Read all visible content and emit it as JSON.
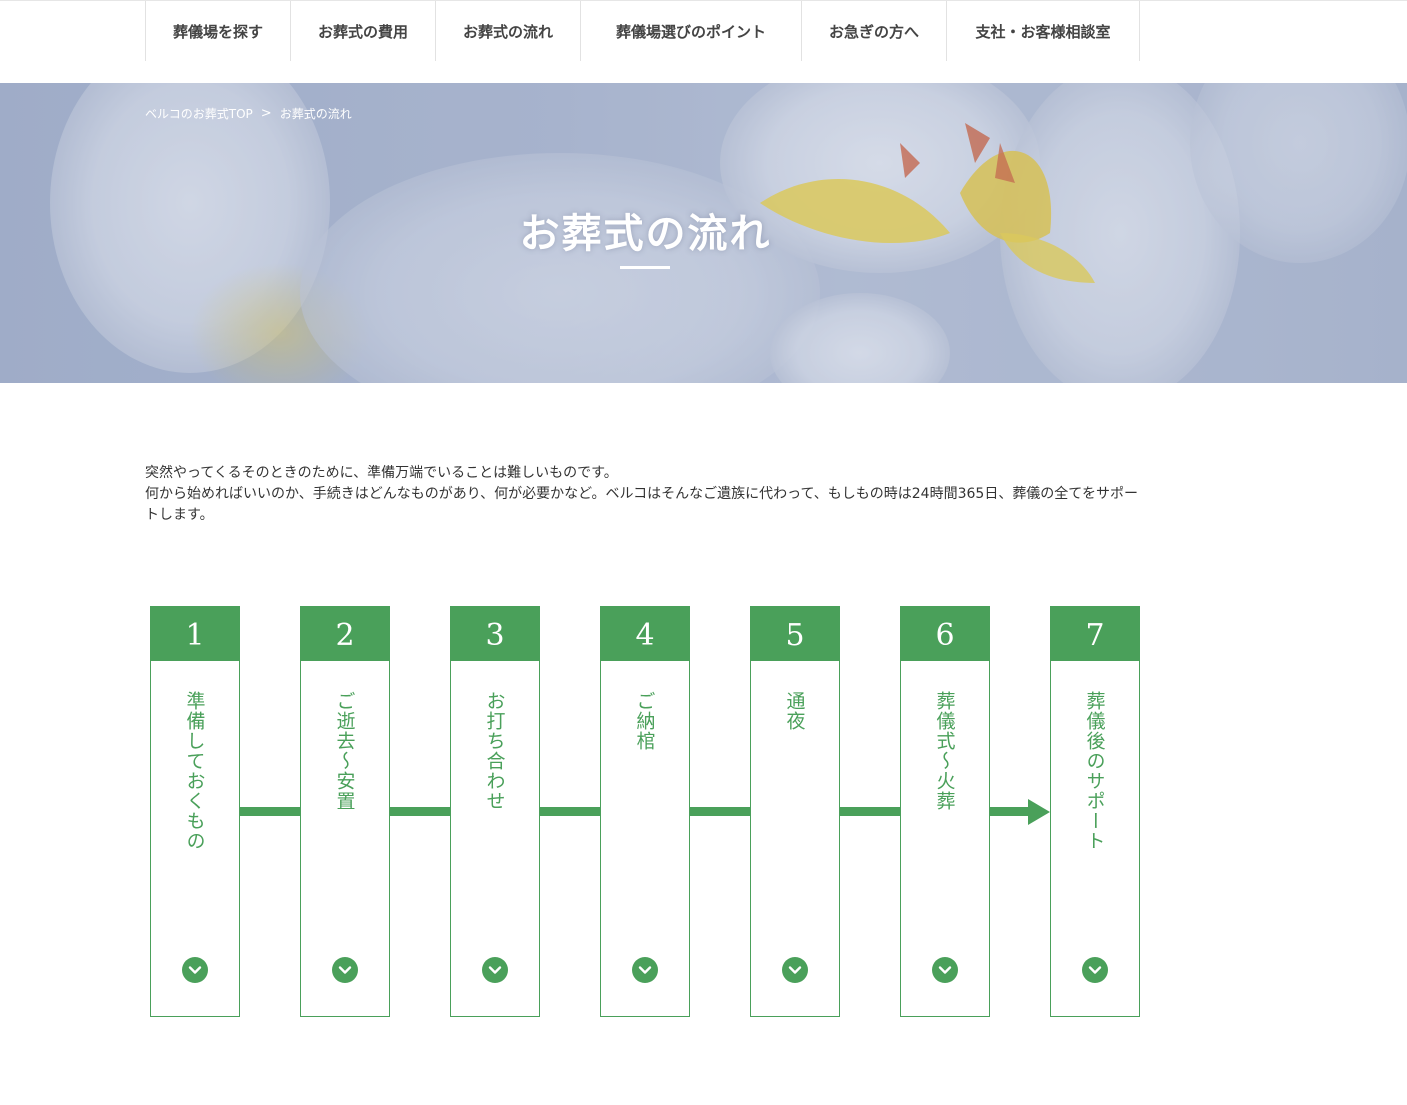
{
  "nav": {
    "items": [
      "葬儀場を探す",
      "お葬式の費用",
      "お葬式の流れ",
      "葬儀場選びのポイント",
      "お急ぎの方へ",
      "支社・お客様相談室"
    ]
  },
  "breadcrumb": {
    "home": "ベルコのお葬式TOP",
    "separator": ">",
    "current": "お葬式の流れ"
  },
  "hero": {
    "title": "お葬式の流れ"
  },
  "intro": {
    "line1": "突然やってくるそのときのために、準備万端でいることは難しいものです。",
    "line2": "何から始めればいいのか、手続きはどんなものがあり、何が必要かなど。ベルコはそんなご遺族に代わって、もしもの時は24時間365日、葬儀の全てをサポートします。"
  },
  "steps": [
    {
      "number": "1",
      "label": "準備しておくもの",
      "icon": "chevron-down-icon"
    },
    {
      "number": "2",
      "label": "ご逝去～安置",
      "icon": "chevron-down-icon"
    },
    {
      "number": "3",
      "label": "お打ち合わせ",
      "icon": "chevron-down-icon"
    },
    {
      "number": "4",
      "label": "ご納棺",
      "icon": "chevron-down-icon"
    },
    {
      "number": "5",
      "label": "通夜",
      "icon": "chevron-down-icon"
    },
    {
      "number": "6",
      "label": "葬儀式～火葬",
      "icon": "chevron-down-icon"
    },
    {
      "number": "7",
      "label": "葬儀後のサポート",
      "icon": "chevron-down-icon"
    }
  ],
  "colors": {
    "accent_green": "#4aa05a",
    "hero_overlay": "#a9b5cd"
  }
}
